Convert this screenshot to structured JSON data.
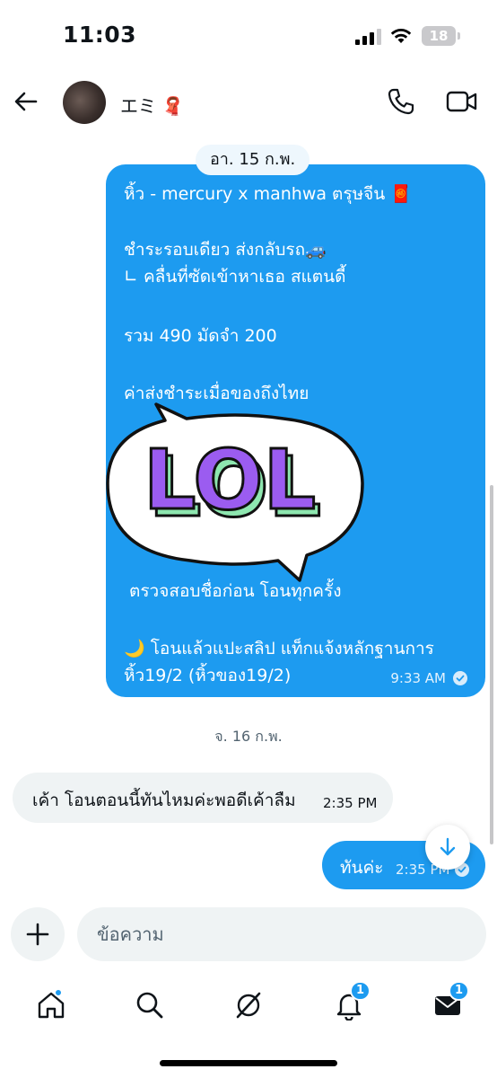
{
  "status_bar": {
    "time": "11:03",
    "battery": "18"
  },
  "header": {
    "contact_name": "エミ 🧣"
  },
  "chat": {
    "date_chip": "อา. 15 ก.พ.",
    "big_message": {
      "lines": [
        "หิ้ว - mercury x manhwa ตรุษจีน 🧧",
        "ชำระรอบเดียว ส่งกลับรถ🚙",
        "∟ คลื่นที่ซัดเข้าหาเธอ สแตนดี้",
        "รวม 490 มัดจำ 200",
        "ค่าส่งชำระเมื่อของถึงไทย",
        "ตรวจสอบชื่อก่อน โอนทุกครั้ง",
        "🌙 โอนแล้วแปะสลิป แท็กแจ้งหลักฐานการ",
        "หิ้ว19/2 (หิ้วของ19/2)"
      ],
      "time": "9:33 AM"
    },
    "sticker_text": "LOL",
    "day_separator": "จ. 16 ก.พ.",
    "received_message": {
      "text": "เค้า โอนตอนนี้ทันไหมค่ะพอดีเค้าลืม",
      "time": "2:35 PM"
    },
    "sent_message": {
      "text": "ทันค่ะ",
      "time": "2:35 PM"
    }
  },
  "composer": {
    "placeholder": "ข้อความ"
  },
  "nav": {
    "notifications_badge": "1",
    "messages_badge": "1"
  }
}
